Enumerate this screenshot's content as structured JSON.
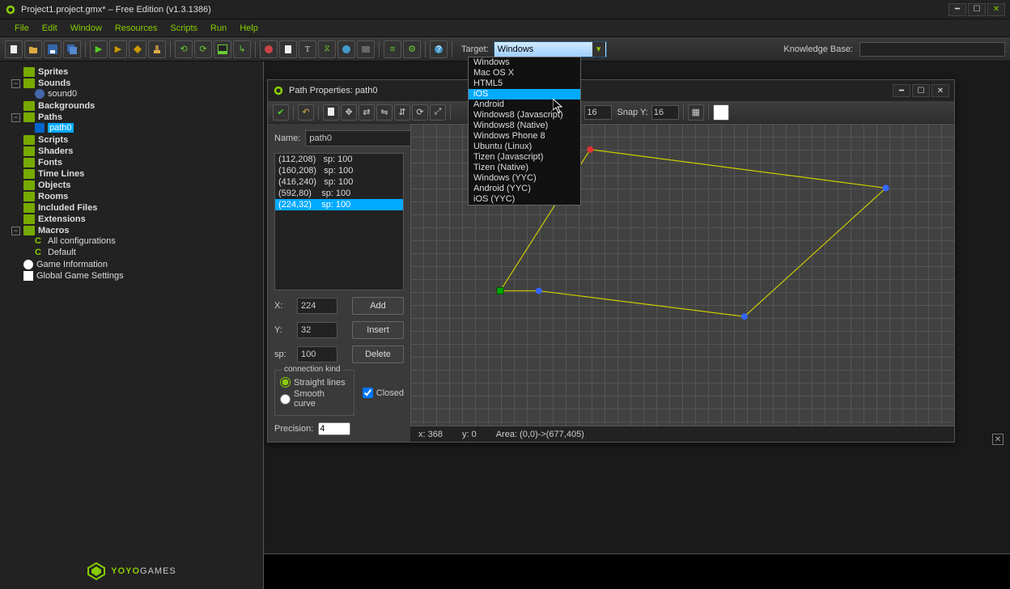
{
  "window": {
    "title": "Project1.project.gmx*  –  Free Edition (v1.3.1386)"
  },
  "menu": {
    "file": "File",
    "edit": "Edit",
    "window": "Window",
    "resources": "Resources",
    "scripts": "Scripts",
    "run": "Run",
    "help": "Help"
  },
  "toolbar": {
    "target_label": "Target:",
    "target_selected": "Windows",
    "kb_label": "Knowledge Base:",
    "kb_value": ""
  },
  "target_options": [
    "Windows",
    "Mac OS X",
    "HTML5",
    "iOS",
    "Android",
    "Windows8 (Javascript)",
    "Windows8 (Native)",
    "Windows Phone 8",
    "Ubuntu (Linux)",
    "Tizen (Javascript)",
    "Tizen (Native)",
    "Windows (YYC)",
    "Android (YYC)",
    "iOS (YYC)"
  ],
  "target_highlight": "iOS",
  "tree": {
    "sprites": "Sprites",
    "sounds": "Sounds",
    "sound0": "sound0",
    "backgrounds": "Backgrounds",
    "paths": "Paths",
    "path0": "path0",
    "scripts": "Scripts",
    "shaders": "Shaders",
    "fonts": "Fonts",
    "timelines": "Time Lines",
    "objects": "Objects",
    "rooms": "Rooms",
    "included": "Included Files",
    "extensions": "Extensions",
    "macros": "Macros",
    "allconfig": "All configurations",
    "default": "Default",
    "gameinfo": "Game Information",
    "ggs": "Global Game Settings"
  },
  "path": {
    "title": "Path Properties: path0",
    "name_label": "Name:",
    "name": "path0",
    "points": [
      {
        "text": "(112,208)   sp: 100"
      },
      {
        "text": "(160,208)   sp: 100"
      },
      {
        "text": "(416,240)   sp: 100"
      },
      {
        "text": "(592,80)    sp: 100"
      },
      {
        "text": "(224,32)    sp: 100",
        "sel": true
      }
    ],
    "x_label": "X:",
    "x": "224",
    "y_label": "Y:",
    "y": "32",
    "sp_label": "sp:",
    "sp": "100",
    "add": "Add",
    "insert": "Insert",
    "delete": "Delete",
    "conn_legend": "connection kind",
    "straight": "Straight lines",
    "smooth": "Smooth curve",
    "closed": "Closed",
    "precision_label": "Precision:",
    "precision": "4",
    "snapx_label": "X:",
    "snapx": "16",
    "snapy_label": "Snap Y:",
    "snapy": "16",
    "status_x": "x: 368",
    "status_y": "y: 0",
    "status_area": "Area: (0,0)->(677,405)"
  },
  "footer": {
    "brand": "YOYO",
    "brand2": "GAMES"
  }
}
